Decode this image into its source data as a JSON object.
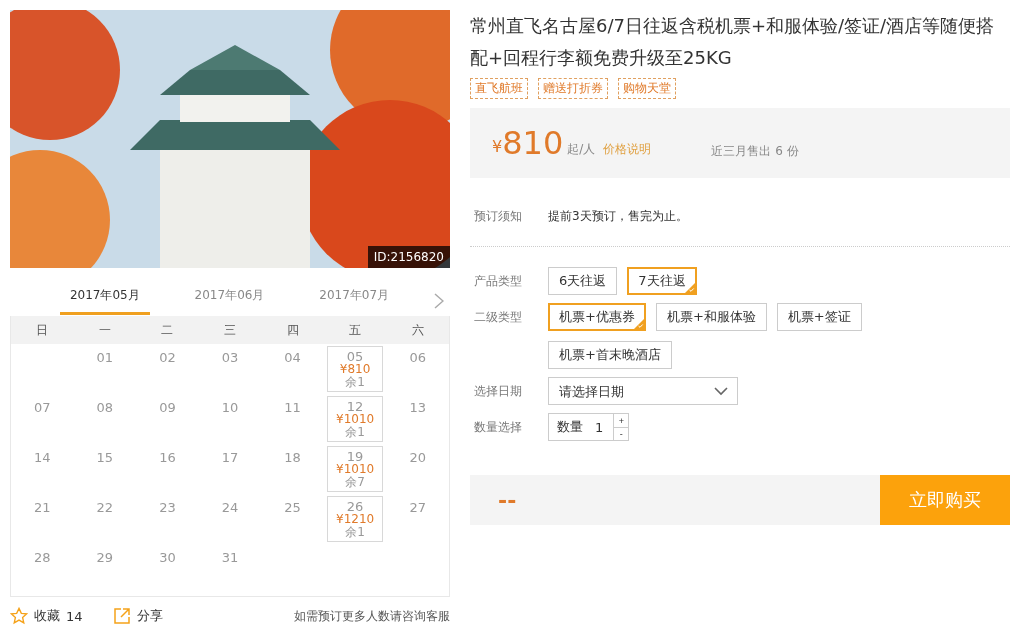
{
  "photo": {
    "id_badge": "ID:2156820"
  },
  "calendar": {
    "months": [
      {
        "label": "2017年05月",
        "selected": true
      },
      {
        "label": "2017年06月",
        "selected": false
      },
      {
        "label": "2017年07月",
        "selected": false
      }
    ],
    "weekdays": [
      "日",
      "一",
      "二",
      "三",
      "四",
      "五",
      "六"
    ],
    "cells": [
      {
        "kind": "blank"
      },
      {
        "kind": "day",
        "day": "01"
      },
      {
        "kind": "day",
        "day": "02"
      },
      {
        "kind": "day",
        "day": "03"
      },
      {
        "kind": "day",
        "day": "04"
      },
      {
        "kind": "priced",
        "day": "05",
        "price": "¥810",
        "stock": "余1"
      },
      {
        "kind": "day",
        "day": "06"
      },
      {
        "kind": "day",
        "day": "07"
      },
      {
        "kind": "day",
        "day": "08"
      },
      {
        "kind": "day",
        "day": "09"
      },
      {
        "kind": "day",
        "day": "10"
      },
      {
        "kind": "day",
        "day": "11"
      },
      {
        "kind": "priced",
        "day": "12",
        "price": "¥1010",
        "stock": "余1"
      },
      {
        "kind": "day",
        "day": "13"
      },
      {
        "kind": "day",
        "day": "14"
      },
      {
        "kind": "day",
        "day": "15"
      },
      {
        "kind": "day",
        "day": "16"
      },
      {
        "kind": "day",
        "day": "17"
      },
      {
        "kind": "day",
        "day": "18"
      },
      {
        "kind": "priced",
        "day": "19",
        "price": "¥1010",
        "stock": "余7"
      },
      {
        "kind": "day",
        "day": "20"
      },
      {
        "kind": "day",
        "day": "21"
      },
      {
        "kind": "day",
        "day": "22"
      },
      {
        "kind": "day",
        "day": "23"
      },
      {
        "kind": "day",
        "day": "24"
      },
      {
        "kind": "day",
        "day": "25"
      },
      {
        "kind": "priced",
        "day": "26",
        "price": "¥1210",
        "stock": "余1"
      },
      {
        "kind": "day",
        "day": "27"
      },
      {
        "kind": "day",
        "day": "28"
      },
      {
        "kind": "day",
        "day": "29"
      },
      {
        "kind": "day",
        "day": "30"
      },
      {
        "kind": "day",
        "day": "31"
      }
    ]
  },
  "footer": {
    "favorite": "收藏",
    "favorite_count": "14",
    "share": "分享",
    "note": "如需预订更多人数请咨询客服"
  },
  "title": "常州直飞名古屋6/7日往返含税机票+和服体验/签证/酒店等随便搭配+回程行李额免费升级至25KG",
  "tags": [
    "直飞航班",
    "赠送打折券",
    "购物天堂"
  ],
  "price": {
    "currency": "¥",
    "amount": "810",
    "unit": "起/人",
    "link": "价格说明",
    "sold": "近三月售出 6 份"
  },
  "notice": {
    "label": "预订须知",
    "text": "提前3天预订，售完为止。"
  },
  "options": [
    {
      "label": "产品类型",
      "choices": [
        {
          "label": "6天往返",
          "selected": false
        },
        {
          "label": "7天往返",
          "selected": true
        }
      ]
    },
    {
      "label": "二级类型",
      "choices": [
        {
          "label": "机票+优惠券",
          "selected": true
        },
        {
          "label": "机票+和服体验",
          "selected": false
        },
        {
          "label": "机票+签证",
          "selected": false
        },
        {
          "label": "机票+首末晚酒店",
          "selected": false
        }
      ]
    }
  ],
  "date": {
    "label": "选择日期",
    "placeholder": "请选择日期"
  },
  "quantity": {
    "label": "数量选择",
    "field_label": "数量",
    "value": "1",
    "plus": "+",
    "minus": "-"
  },
  "buy": {
    "total": "--",
    "button": "立即购买"
  }
}
